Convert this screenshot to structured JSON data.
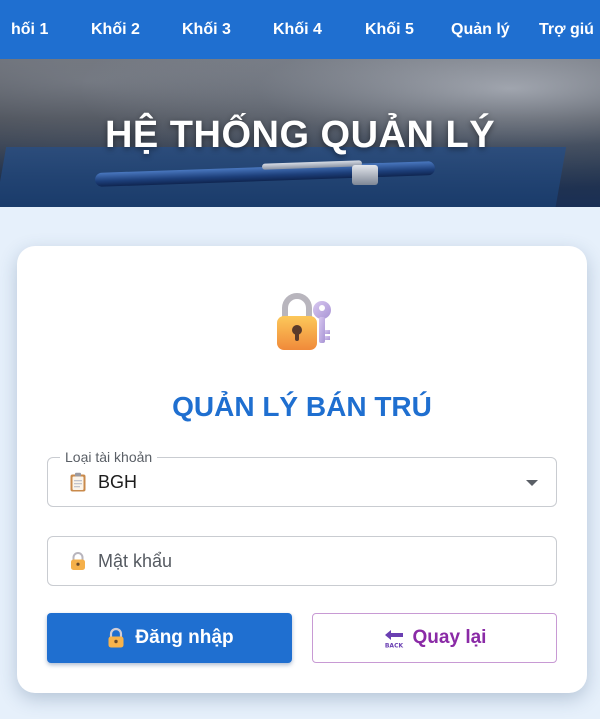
{
  "nav": {
    "items": [
      {
        "label": "hối 1"
      },
      {
        "label": "Khối 2"
      },
      {
        "label": "Khối 3"
      },
      {
        "label": "Khối 4"
      },
      {
        "label": "Khối 5"
      },
      {
        "label": "Quản lý"
      },
      {
        "label": "Trợ giú"
      }
    ]
  },
  "banner": {
    "title": "HỆ THỐNG QUẢN LÝ"
  },
  "login": {
    "icon": "lock-with-key-icon",
    "title": "QUẢN LÝ BÁN TRÚ",
    "account_type": {
      "legend": "Loại tài khoản",
      "icon": "clipboard-icon",
      "value": "BGH"
    },
    "password": {
      "icon": "lock-icon",
      "placeholder": "Mật khẩu",
      "value": ""
    },
    "login_button": {
      "icon": "lock-icon",
      "label": "Đăng nhập"
    },
    "back_button": {
      "icon": "back-arrow-icon",
      "label": "Quay lại"
    }
  },
  "colors": {
    "primary": "#1f6fd0",
    "back_text": "#8a2aa6",
    "background": "#e6f0fb"
  }
}
